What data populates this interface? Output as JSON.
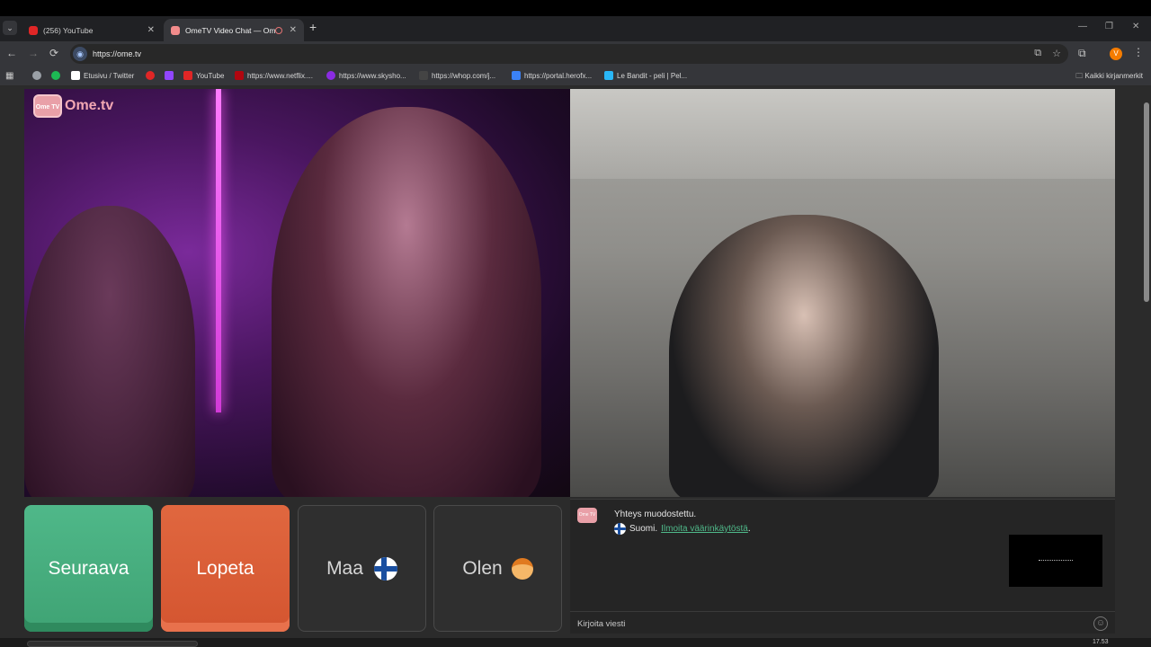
{
  "browser": {
    "tabs": [
      {
        "title": "(256) YouTube",
        "active": false,
        "favicon_color": "#e02626"
      },
      {
        "title": "OmeTV Video Chat — Ome",
        "active": true,
        "favicon_color": "#f28b8b"
      }
    ],
    "close_glyph": "✕",
    "new_tab_glyph": "+",
    "tab_list_glyph": "⌄",
    "url": "https://ome.tv",
    "window_controls": {
      "minimize": "—",
      "maximize": "❐",
      "close": "✕"
    },
    "nav": {
      "back": "←",
      "forward": "→",
      "reload": "⟳"
    },
    "omnibox_icons": {
      "install": "⧉",
      "star": "☆"
    },
    "profile_initial": "V",
    "bookmarks": [
      {
        "label": "",
        "icon_color": "#9aa0a6"
      },
      {
        "label": "",
        "icon_color": "#1db954"
      },
      {
        "label": "Etusivu / Twitter",
        "icon_color": "#ffffff"
      },
      {
        "label": "",
        "icon_color": "#e02626"
      },
      {
        "label": "",
        "icon_color": "#9146ff"
      },
      {
        "label": "YouTube",
        "icon_color": "#e02626"
      },
      {
        "label": "https://www.netflix....",
        "icon_color": "#b0060f"
      },
      {
        "label": "https://www.skysho...",
        "icon_color": "#8a2be2"
      },
      {
        "label": "https://whop.com/j...",
        "icon_color": "#444444"
      },
      {
        "label": "https://portal.herofx...",
        "icon_color": "#3b82f6"
      },
      {
        "label": "Le Bandit - peli | Pel...",
        "icon_color": "#29b6f6"
      }
    ],
    "all_bookmarks_label": "Kaikki kirjanmerkit"
  },
  "app": {
    "logo_badge": "Ome TV",
    "logo_text": "Ome.tv",
    "buttons": {
      "next": "Seuraava",
      "stop": "Lopeta",
      "country": "Maa",
      "gender": "Olen"
    },
    "chat": {
      "status": "Yhteys muodostettu.",
      "country_text": "Suomi.",
      "report_link": "Ilmoita väärinkäytöstä",
      "report_suffix": ".",
      "input_placeholder": "Kirjoita viesti",
      "emoji_icon": "☺"
    },
    "colors": {
      "next_button": "#4fb889",
      "stop_button": "#e0673f",
      "report_link": "#4fb889"
    }
  },
  "taskbar": {
    "clock": "17.53"
  }
}
